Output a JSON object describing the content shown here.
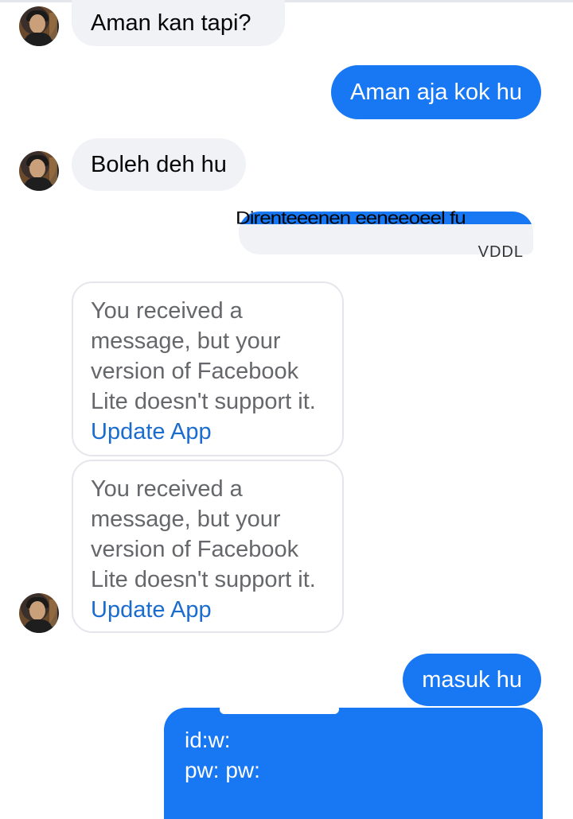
{
  "messages": {
    "m1": {
      "text": "Aman kan tapi?"
    },
    "m2": {
      "text": "Aman aja kok hu"
    },
    "m3": {
      "text": "Boleh deh hu"
    },
    "m4": {
      "line1": "Direnteeenen eeneeoeel fu",
      "line2": "VDDL"
    },
    "m5": {
      "text": "You received a message, but your version of Facebook Lite doesn't support it.",
      "link": "Update App"
    },
    "m6": {
      "text": "You received a message, but your version of Facebook Lite doesn't support it.",
      "link": "Update App"
    },
    "m7": {
      "text": "masuk hu"
    },
    "m8": {
      "line1": "id:w:",
      "line2": "pw:  pw:"
    }
  },
  "colors": {
    "sent_bubble": "#1877f2",
    "received_bubble": "#f0f2f5",
    "link": "#1a6ccf",
    "muted_text": "#65676b"
  }
}
